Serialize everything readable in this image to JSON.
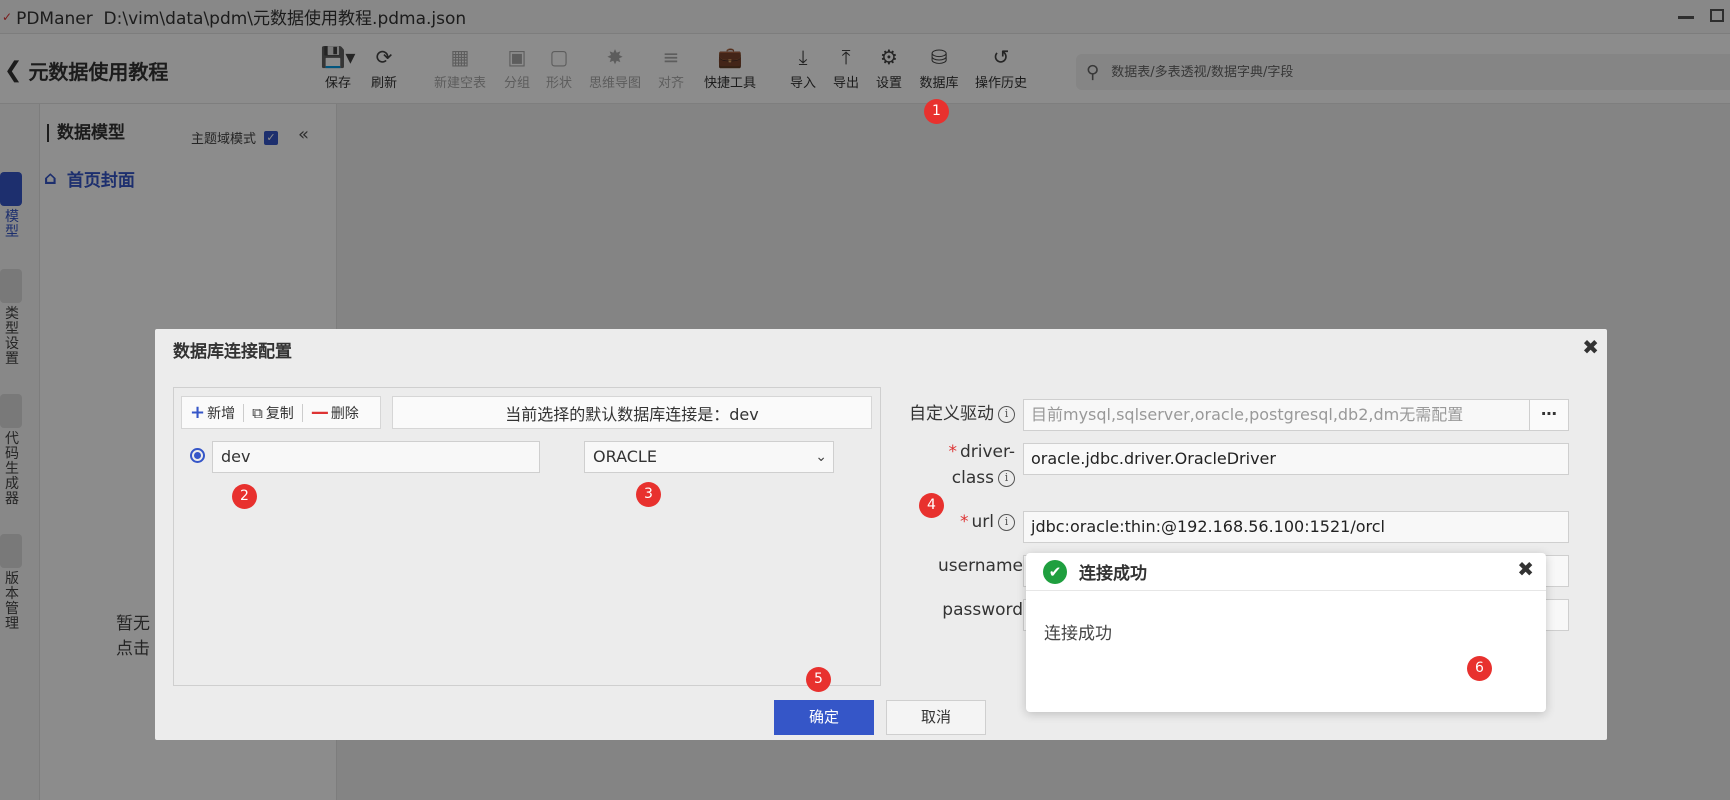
{
  "window": {
    "app_name": "PDManer",
    "file_path": "D:\\vim\\data\\pdm\\元数据使用教程.pdma.json"
  },
  "header": {
    "project_title": "元数据使用教程"
  },
  "toolbar": {
    "save": "保存",
    "refresh": "刷新",
    "new_empty_table": "新建空表",
    "group": "分组",
    "shape": "形状",
    "mind_map": "思维导图",
    "align": "对齐",
    "quick_tools": "快捷工具",
    "import": "导入",
    "export": "导出",
    "settings": "设置",
    "database": "数据库",
    "history": "操作历史"
  },
  "search": {
    "placeholder": "数据表/多表透视/数据字典/字段"
  },
  "rail": {
    "model": "模型",
    "types": "类型设置",
    "codegen": "代码生成器",
    "version": "版本管理"
  },
  "side_panel": {
    "title": "数据模型",
    "theme_mode_label": "主题域模式",
    "theme_mode_checked": true,
    "home_item": "首页封面",
    "empty_line1": "暂无",
    "empty_line2": "点击"
  },
  "dialog": {
    "title": "数据库连接配置",
    "actions": {
      "add": "新增",
      "copy": "复制",
      "delete": "删除"
    },
    "default_info": "当前选择的默认数据库连接是：dev",
    "connection": {
      "name": "dev",
      "db_type": "ORACLE"
    },
    "fields": {
      "custom_driver_label": "自定义驱动",
      "custom_driver_placeholder": "目前mysql,sqlserver,oracle,postgresql,db2,dm无需配置",
      "driver_class_label_1": "driver-",
      "driver_class_label_2": "class",
      "driver_class_value": "oracle.jdbc.driver.OracleDriver",
      "url_label": "url",
      "url_value": "jdbc:oracle:thin:@192.168.56.100:1521/orcl",
      "username_label": "username",
      "password_label": "password"
    },
    "ok": "确定",
    "cancel": "取消"
  },
  "toast": {
    "title": "连接成功",
    "message": "连接成功"
  },
  "markers": [
    "1",
    "2",
    "3",
    "4",
    "5",
    "6"
  ],
  "colors": {
    "accent": "#3556c8",
    "marker": "#e8312e",
    "success": "#1f9f3f"
  }
}
